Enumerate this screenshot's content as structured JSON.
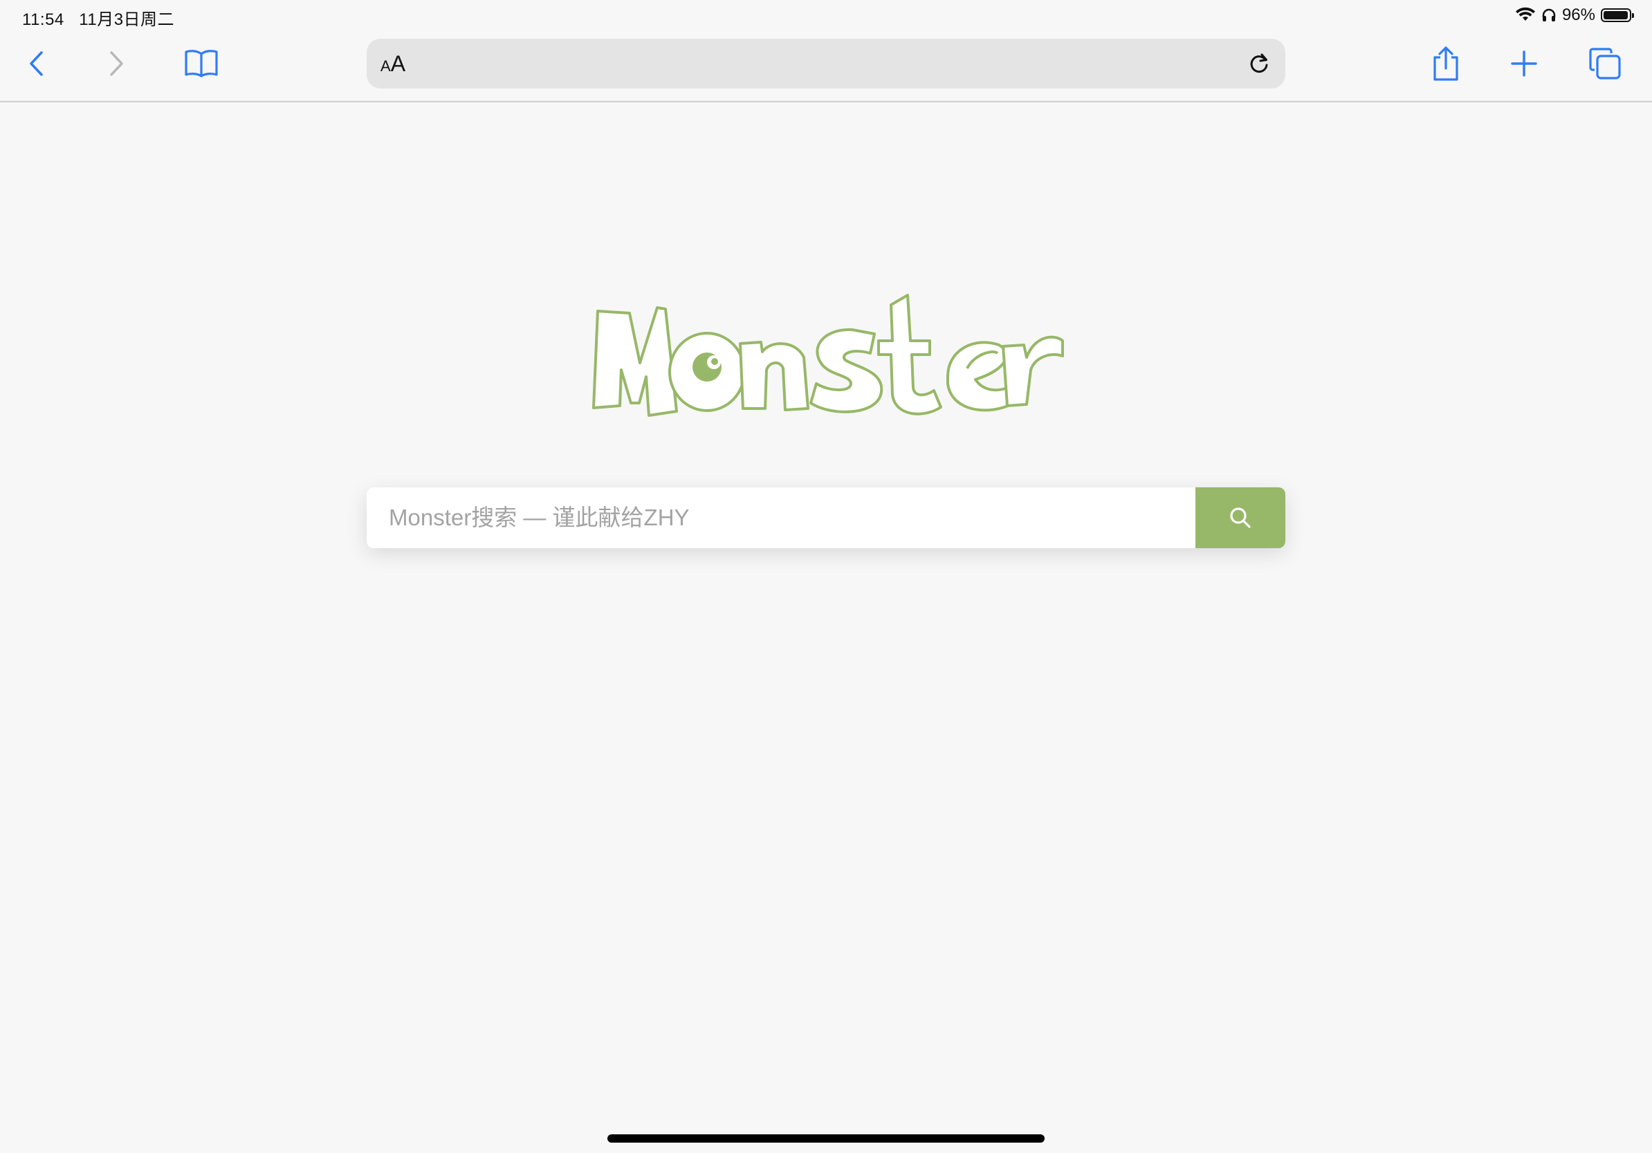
{
  "status_bar": {
    "time": "11:54",
    "date": "11月3日周二",
    "battery_percent": "96%",
    "battery_level": 0.96
  },
  "toolbar": {
    "back_icon": "chevron-left-icon",
    "forward_icon": "chevron-right-icon",
    "bookmarks_icon": "book-icon",
    "address": {
      "reader_label_small": "A",
      "reader_label_large": "A",
      "url": ""
    },
    "share_icon": "share-icon",
    "new_tab_icon": "plus-icon",
    "tabs_icon": "tabs-icon"
  },
  "main": {
    "logo_text": "Monster",
    "search": {
      "placeholder": "Monster搜索 — 谨此献给ZHY",
      "value": "",
      "button_icon": "search-icon"
    }
  },
  "colors": {
    "accent": "#97b868",
    "ios_blue": "#2f7cf6",
    "background": "#f7f7f7"
  }
}
